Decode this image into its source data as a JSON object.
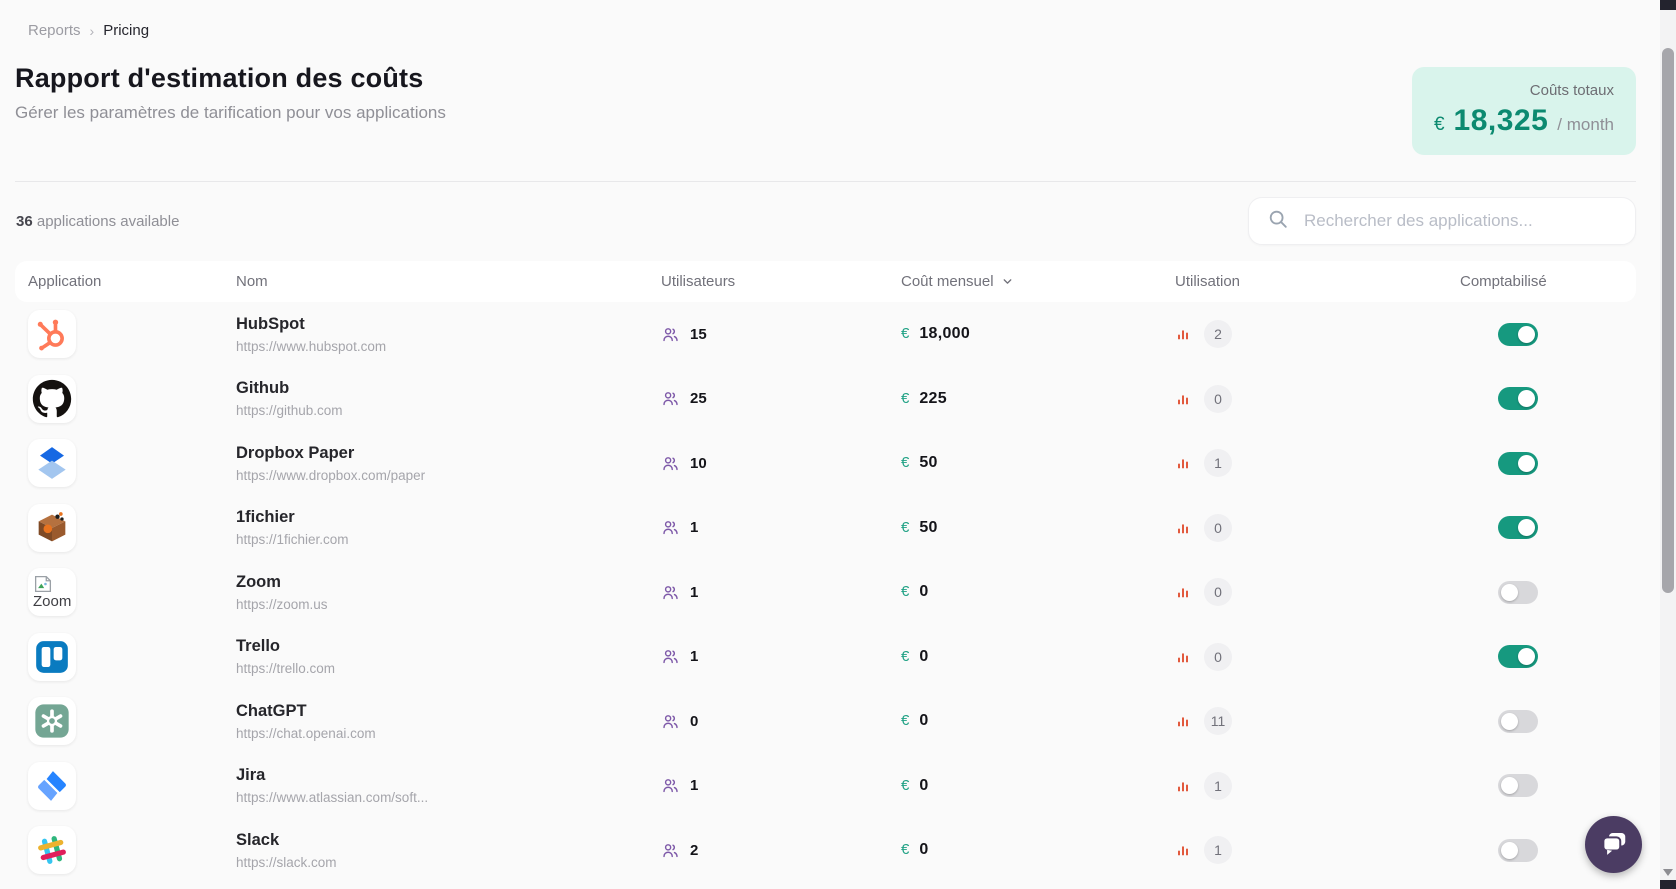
{
  "breadcrumb": {
    "items": [
      "Reports",
      "Pricing"
    ],
    "separator": "›"
  },
  "header": {
    "title": "Rapport d'estimation des coûts",
    "subtitle": "Gérer les paramètres de tarification pour vos applications",
    "total_card": {
      "label": "Coûts totaux",
      "currency": "€",
      "amount": "18,325",
      "period": "/ month"
    }
  },
  "toolbar": {
    "count_number": "36",
    "count_label": " applications available",
    "search_placeholder": "Rechercher des applications..."
  },
  "table": {
    "currency_symbol": "€",
    "columns": [
      "Application",
      "Nom",
      "Utilisateurs",
      "Coût mensuel",
      "Utilisation",
      "Comptabilisé"
    ],
    "sorted_column": "Coût mensuel",
    "sort_direction": "desc",
    "rows": [
      {
        "app": "hubspot",
        "name": "HubSpot",
        "url": "https://www.hubspot.com",
        "users": "15",
        "cost": "18,000",
        "usage": "2",
        "enabled": true
      },
      {
        "app": "github",
        "name": "Github",
        "url": "https://github.com",
        "users": "25",
        "cost": "225",
        "usage": "0",
        "enabled": true
      },
      {
        "app": "dropbox",
        "name": "Dropbox Paper",
        "url": "https://www.dropbox.com/paper",
        "users": "10",
        "cost": "50",
        "usage": "1",
        "enabled": true
      },
      {
        "app": "fichier",
        "name": "1fichier",
        "url": "https://1fichier.com",
        "users": "1",
        "cost": "50",
        "usage": "0",
        "enabled": true
      },
      {
        "app": "zoom",
        "name": "Zoom",
        "url": "https://zoom.us",
        "users": "1",
        "cost": "0",
        "usage": "0",
        "enabled": false,
        "icon_broken": true,
        "icon_alt": "Zoom"
      },
      {
        "app": "trello",
        "name": "Trello",
        "url": "https://trello.com",
        "users": "1",
        "cost": "0",
        "usage": "0",
        "enabled": true
      },
      {
        "app": "chatgpt",
        "name": "ChatGPT",
        "url": "https://chat.openai.com",
        "users": "0",
        "cost": "0",
        "usage": "11",
        "enabled": false
      },
      {
        "app": "jira",
        "name": "Jira",
        "url": "https://www.atlassian.com/soft...",
        "users": "1",
        "cost": "0",
        "usage": "1",
        "enabled": false
      },
      {
        "app": "slack",
        "name": "Slack",
        "url": "https://slack.com",
        "users": "2",
        "cost": "0",
        "usage": "1",
        "enabled": false
      }
    ]
  },
  "colors": {
    "accent_teal": "#16997f",
    "card_mint": "#d9f4ec",
    "total_text": "#0c8a70",
    "users_purple": "#7d58a8",
    "usage_orange": "#e2593d",
    "toggle_off": "#d8d8db",
    "chat_purple": "#4b3c63"
  }
}
